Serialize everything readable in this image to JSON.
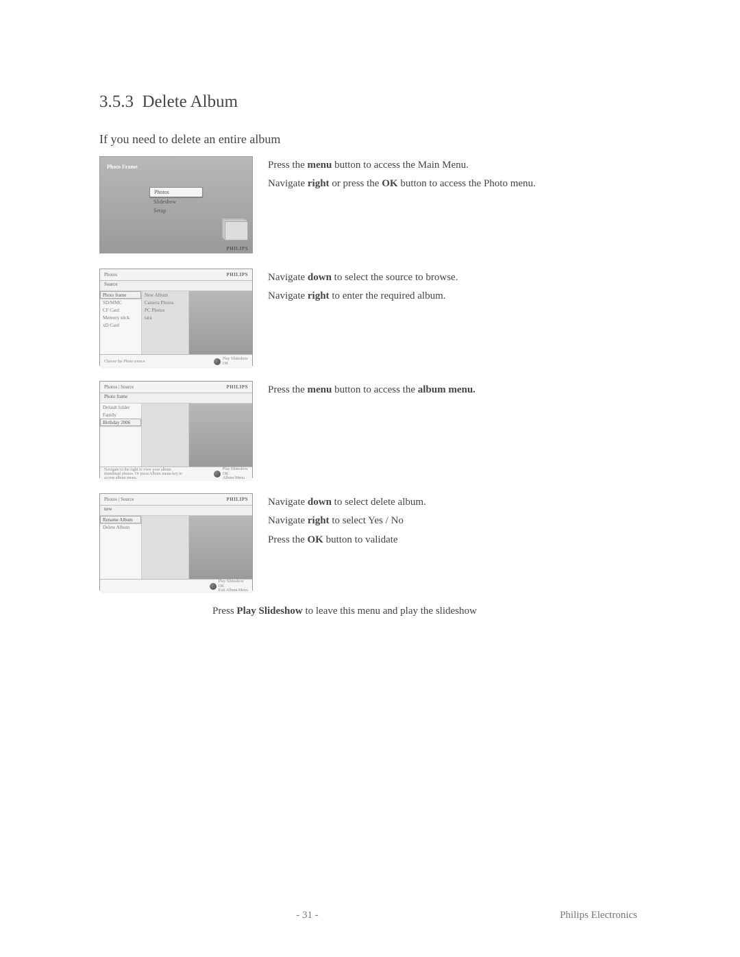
{
  "section": {
    "number": "3.5.3",
    "title": "Delete Album"
  },
  "subtitle": "If you need to delete an entire album",
  "steps": [
    {
      "lines": [
        {
          "pre": "Press the ",
          "b1": "menu",
          "mid": " button to access the Main Menu.",
          "b2": "",
          "post": ""
        },
        {
          "pre": "Navigate ",
          "b1": "right",
          "mid": " or press the ",
          "b2": "OK",
          "post": " button to access the Photo menu."
        }
      ],
      "shot": {
        "type": "main",
        "title": "Photo Frame",
        "menu": [
          "Photos",
          "Slideshow",
          "Setup"
        ],
        "brand": "PHILIPS"
      }
    },
    {
      "lines": [
        {
          "pre": "Navigate ",
          "b1": "down",
          "mid": " to select the source to browse.",
          "b2": "",
          "post": ""
        },
        {
          "pre": "Navigate ",
          "b1": "right",
          "mid": " to enter the required album.",
          "b2": "",
          "post": ""
        }
      ],
      "shot": {
        "type": "list",
        "hdr": "Photos",
        "brand": "PHILIPS",
        "sub": "Source",
        "col1": [
          "Photo frame",
          "SD/MMC",
          "CF Card",
          "Memory stick",
          "xD Card"
        ],
        "col1_sel": 0,
        "col2": [
          "New Album",
          "Camera Photos",
          "PC Photos",
          "tara"
        ],
        "btm_left": "Choose the Photo source",
        "btm_ctrl": [
          "Play Slideshow",
          "OK",
          ""
        ]
      }
    },
    {
      "lines": [
        {
          "pre": "Press the ",
          "b1": "menu",
          "mid": " button to access the ",
          "b2": "album menu.",
          "post": ""
        }
      ],
      "shot": {
        "type": "list",
        "hdr": "Photos | Source",
        "brand": "PHILIPS",
        "sub": "Photo frame",
        "col1": [
          "Default folder",
          "Family",
          "Birthday 2006"
        ],
        "col1_sel": 2,
        "col2": [],
        "btm_left": "Navigate to the right to view your album thumbnail photos. Or press Album menu key to access album menu.",
        "btm_ctrl": [
          "Play Slideshow",
          "OK",
          "Album Menu"
        ]
      }
    },
    {
      "lines": [
        {
          "pre": "Navigate ",
          "b1": "down",
          "mid": " to select delete album.",
          "b2": "",
          "post": ""
        },
        {
          "pre": "Navigate ",
          "b1": "right",
          "mid": " to select Yes / No",
          "b2": "",
          "post": ""
        },
        {
          "pre": "Press the ",
          "b1": "OK",
          "mid": " button to validate",
          "b2": "",
          "post": ""
        }
      ],
      "shot": {
        "type": "list",
        "hdr": "Photos | Source",
        "brand": "PHILIPS",
        "sub": "new",
        "col1": [
          "Rename Album",
          "Delete Album"
        ],
        "col1_sel": 0,
        "col2": [],
        "btm_left": "",
        "btm_ctrl": [
          "Play Slideshow",
          "OK",
          "Exit Album Menu"
        ]
      }
    }
  ],
  "final_note": {
    "pre": "Press ",
    "b": "Play Slideshow",
    "post": " to leave this menu and play the slideshow"
  },
  "footer": {
    "page": "- 31 -",
    "company": "Philips Electronics"
  }
}
